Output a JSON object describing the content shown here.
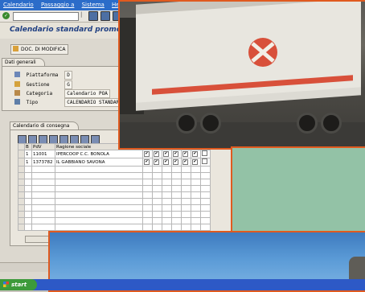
{
  "sap": {
    "menu": [
      "Calendario",
      "Passaggio a",
      "Sistema",
      "Help"
    ],
    "title": "Calendario standard promozionale",
    "app_button": "DOC. DI MODIFICA",
    "tab_general": "Dati generali",
    "fields": [
      {
        "label": "Piattaforma",
        "value": "D",
        "icon": "pallet-icon"
      },
      {
        "label": "Gestione",
        "value": "G",
        "icon": "folder-icon"
      },
      {
        "label": "Categoria",
        "value": "Calendario POA",
        "icon": "category-icon"
      },
      {
        "label": "Tipo",
        "value": "CALENDARIO STANDARD",
        "icon": "type-icon"
      }
    ],
    "tab_calendar": "Calendario di consegna",
    "grid": {
      "headers": [
        "B",
        "PdV",
        "Ragione sociale"
      ],
      "rows": [
        {
          "b": "1",
          "pdv": "11001",
          "name": "IPERCOOP C.C. BONOLA"
        },
        {
          "b": "1",
          "pdv": "1373782",
          "name": "IL GABBIANO SAVONA"
        }
      ],
      "check_mark": "✔"
    }
  },
  "taskbar": {
    "start_label": "start"
  },
  "accent_border": "#e05a1f"
}
